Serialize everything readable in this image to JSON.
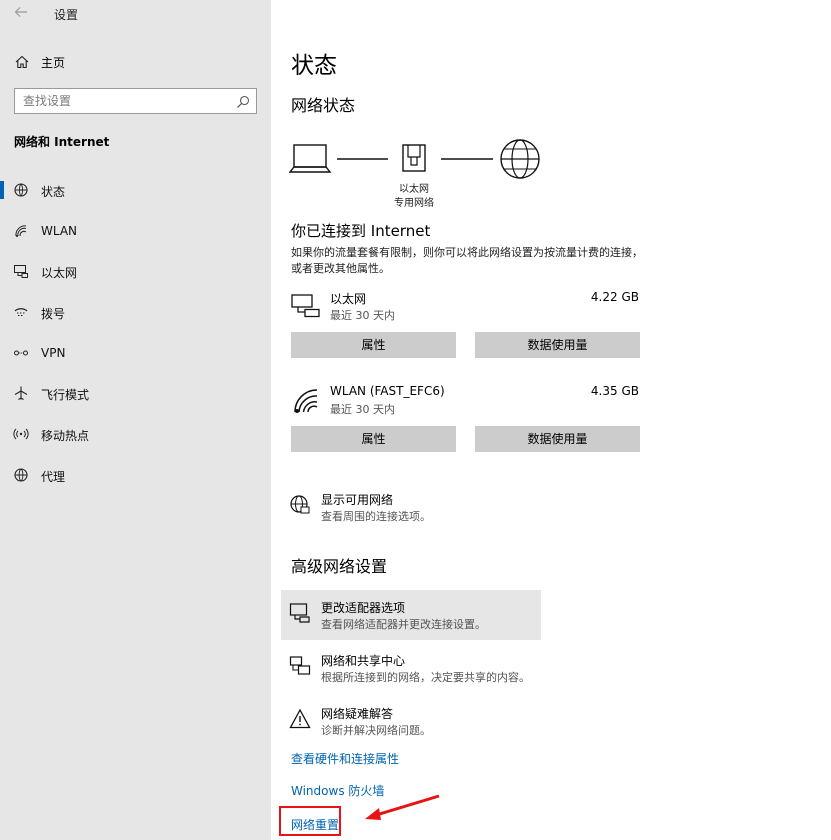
{
  "app_title": "设置",
  "sidebar": {
    "home_label": "主页",
    "search_placeholder": "查找设置",
    "section_title": "网络和 Internet",
    "items": [
      {
        "label": "状态",
        "icon": "status-icon"
      },
      {
        "label": "WLAN",
        "icon": "wifi-icon"
      },
      {
        "label": "以太网",
        "icon": "ethernet-icon"
      },
      {
        "label": "拨号",
        "icon": "dialup-icon"
      },
      {
        "label": "VPN",
        "icon": "vpn-icon"
      },
      {
        "label": "飞行模式",
        "icon": "airplane-icon"
      },
      {
        "label": "移动热点",
        "icon": "hotspot-icon"
      },
      {
        "label": "代理",
        "icon": "globe-icon"
      }
    ],
    "selected": "状态"
  },
  "main": {
    "page_title": "状态",
    "network_status_title": "网络状态",
    "diagram_label_line1": "以太网",
    "diagram_label_line2": "专用网络",
    "connected_title": "你已连接到 Internet",
    "connected_desc": "如果你的流量套餐有限制，则你可以将此网络设置为按流量计费的连接，或者更改其他属性。",
    "connections": [
      {
        "name": "以太网",
        "size": "4.22 GB",
        "period": "最近 30 天内",
        "btn_properties": "属性",
        "btn_usage": "数据使用量"
      },
      {
        "name": "WLAN (FAST_EFC6)",
        "size": "4.35 GB",
        "period": "最近 30 天内",
        "btn_properties": "属性",
        "btn_usage": "数据使用量"
      }
    ],
    "show_networks": {
      "title": "显示可用网络",
      "desc": "查看周围的连接选项。"
    },
    "advanced_title": "高级网络设置",
    "adapter_options": {
      "title": "更改适配器选项",
      "desc": "查看网络适配器并更改连接设置。"
    },
    "sharing_center": {
      "title": "网络和共享中心",
      "desc": "根据所连接到的网络，决定要共享的内容。"
    },
    "troubleshooter": {
      "title": "网络疑难解答",
      "desc": "诊断并解决网络问题。"
    },
    "link_hardware": "查看硬件和连接属性",
    "link_firewall": "Windows 防火墙",
    "link_reset": "网络重置"
  },
  "colors": {
    "accent": "#0063b1",
    "annotation": "#e81414",
    "sidebar_bg": "#e6e6e6",
    "button_bg": "#cccccc"
  }
}
